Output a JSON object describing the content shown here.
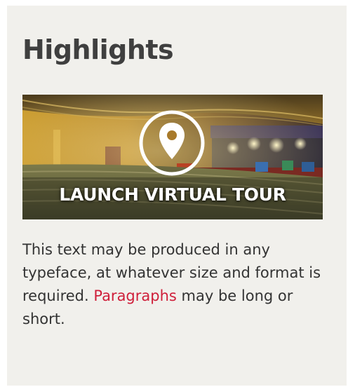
{
  "widget": {
    "title": "Highlights",
    "tour": {
      "label": "LAUNCH VIRTUAL TOUR",
      "icon": "location-pin-icon"
    },
    "paragraph": {
      "text_before": "This text may be produced in any typeface, at whatever size and format is required. ",
      "link_text": "Paragraphs",
      "text_after": " may be long or short."
    },
    "colors": {
      "panel_bg": "#f1f0ec",
      "title": "#3f3f3f",
      "body_text": "#333333",
      "link": "#cf1f3a"
    }
  }
}
